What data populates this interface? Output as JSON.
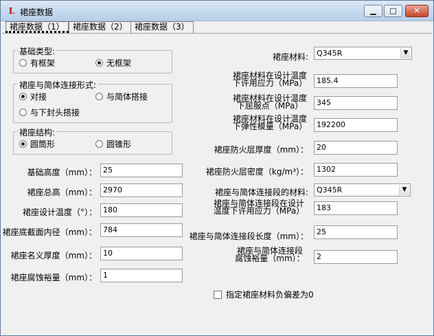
{
  "window": {
    "title": "裙座数据",
    "app_icon_text": "L"
  },
  "tabs": [
    "裙座数据（1）",
    "裙座数据（2）",
    "裙座数据（3）"
  ],
  "foundation": {
    "legend": "基础类型:",
    "options": [
      "有框架",
      "无框架"
    ],
    "selected": "无框架"
  },
  "connection": {
    "legend": "裙座与简体连接形式:",
    "options": [
      "对接",
      "与简体搭接",
      "与下封头搭接"
    ],
    "selected": "对接"
  },
  "structure": {
    "legend": "裙座结构:",
    "options": [
      "圆筒形",
      "圆锥形"
    ],
    "selected": "圆筒形"
  },
  "left_fields": [
    {
      "label": "基础高度（mm）：",
      "value": "25"
    },
    {
      "label": "裙座总高（mm）：",
      "value": "2970"
    },
    {
      "label": "裙座设计温度（°）：",
      "value": "180"
    },
    {
      "label": "裙座底截面内径（mm）：",
      "value": "784"
    },
    {
      "label": "裙座名义厚度（mm）：",
      "value": "10"
    },
    {
      "label": "裙座腐蚀裕量（mm）：",
      "value": "1"
    }
  ],
  "right": {
    "material_label": "裙座材料:",
    "material_value": "Q345R",
    "allow_stress_label": [
      "裙座材料在设计温度",
      "下许用应力（MPa）"
    ],
    "allow_stress_value": "185.4",
    "yield_label": [
      "裙座材料在设计温度",
      "下屈服点（MPa）"
    ],
    "yield_value": "345",
    "modulus_label": [
      "裙座材料在设计温度",
      "下弹性模量（MPa）"
    ],
    "modulus_value": "192200",
    "fire_thk_label": "裙座防火层厚度（mm）：",
    "fire_thk_value": "20",
    "fire_density_label": "裙座防火层密度（kg/m³）：",
    "fire_density_value": "1302",
    "conn_material_label": "裙座与简体连接段的材料:",
    "conn_material_value": "Q345R",
    "conn_stress_label": [
      "裙座与简体连接段在设计",
      "温度下许用应力（MPa）"
    ],
    "conn_stress_value": "183",
    "conn_len_label": "裙座与简体连接段长度（mm）：",
    "conn_len_value": "25",
    "conn_corr_label": [
      "裙座与简体连接段",
      "腐蚀裕量（mm）："
    ],
    "conn_corr_value": "2",
    "negative_dev_label": "指定裙座材料负偏差为0"
  }
}
